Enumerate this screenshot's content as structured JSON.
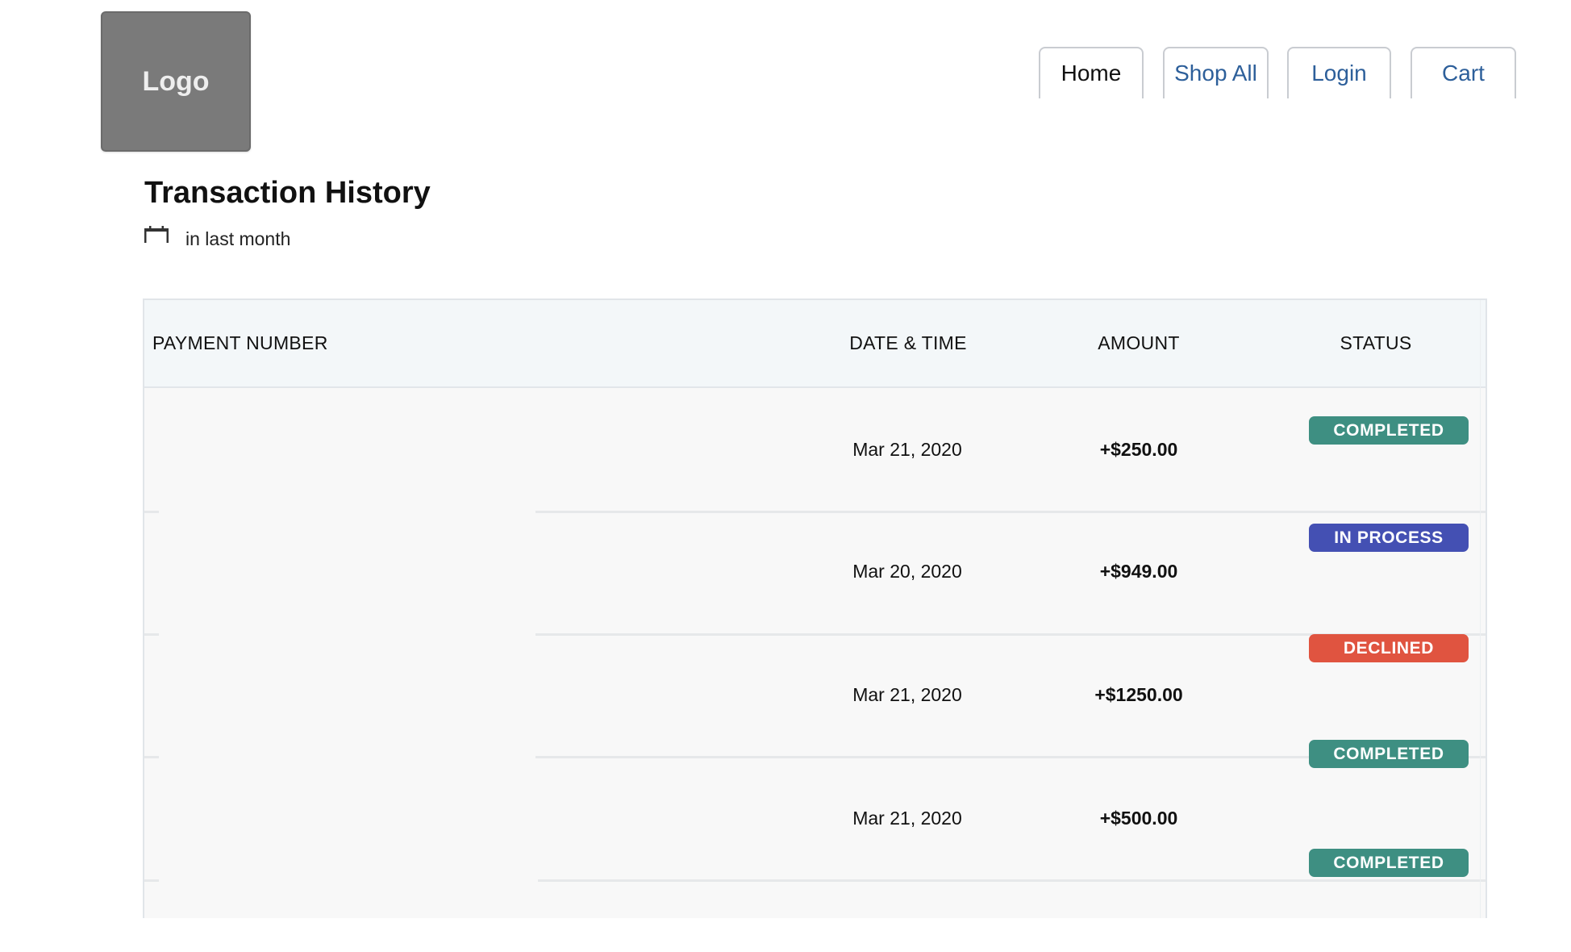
{
  "logo": {
    "label": "Logo"
  },
  "nav": {
    "tabs": [
      {
        "label": "Home",
        "active": true
      },
      {
        "label": "Shop All",
        "active": false
      },
      {
        "label": "Login",
        "active": false
      },
      {
        "label": "Cart",
        "active": false
      }
    ]
  },
  "page": {
    "title": "Transaction History",
    "filter_label": "in last month"
  },
  "table": {
    "headers": {
      "payment_number": "PAYMENT NUMBER",
      "date_time": "DATE & TIME",
      "amount": "AMOUNT",
      "status": "STATUS"
    },
    "rows": [
      {
        "payment_number": "",
        "date": "Mar 21, 2020",
        "amount": "+$250.00"
      },
      {
        "payment_number": "",
        "date": "Mar 20, 2020",
        "amount": "+$949.00"
      },
      {
        "payment_number": "",
        "date": "Mar 21, 2020",
        "amount": "+$1250.00"
      },
      {
        "payment_number": "",
        "date": "Mar 21, 2020",
        "amount": "+$500.00"
      }
    ],
    "badges": [
      {
        "label": "COMPLETED",
        "color": "#3e8f82"
      },
      {
        "label": "IN PROCESS",
        "color": "#4450b3"
      },
      {
        "label": "DECLINED",
        "color": "#e05440"
      },
      {
        "label": "COMPLETED",
        "color": "#3e8f82"
      },
      {
        "label": "COMPLETED",
        "color": "#3e8f82"
      }
    ]
  },
  "colors": {
    "nav_link": "#2d5f9a",
    "header_bg": "#f3f7f9",
    "row_bg": "#f8f8f8"
  }
}
